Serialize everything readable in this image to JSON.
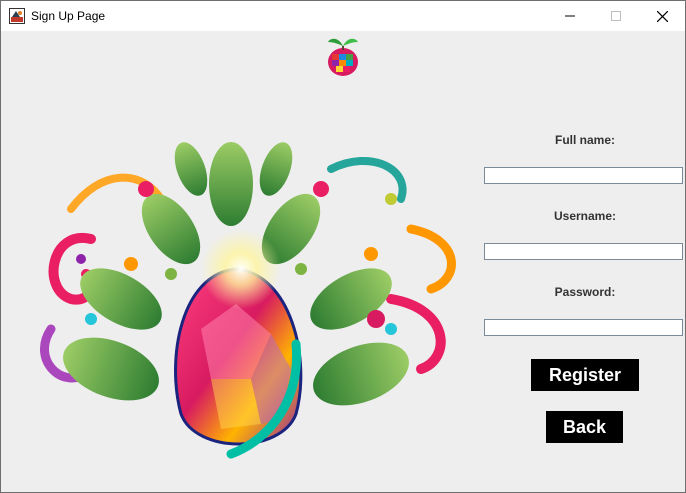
{
  "window": {
    "title": "Sign Up Page",
    "controls": {
      "minimize": "minimize-icon",
      "maximize": "maximize-icon",
      "close": "close-icon"
    }
  },
  "logo": {
    "icon": "apple-logo-icon"
  },
  "illustration": {
    "icon": "jewel-egg-foliage-illustration"
  },
  "form": {
    "fullname_label": "Full name:",
    "fullname_value": "",
    "username_label": "Username:",
    "username_value": "",
    "password_label": "Password:",
    "password_value": ""
  },
  "buttons": {
    "register": "Register",
    "back": "Back"
  },
  "colors": {
    "background": "#eeeeee",
    "button_bg": "#000000",
    "button_text": "#ffffff",
    "label_text": "#333333"
  }
}
